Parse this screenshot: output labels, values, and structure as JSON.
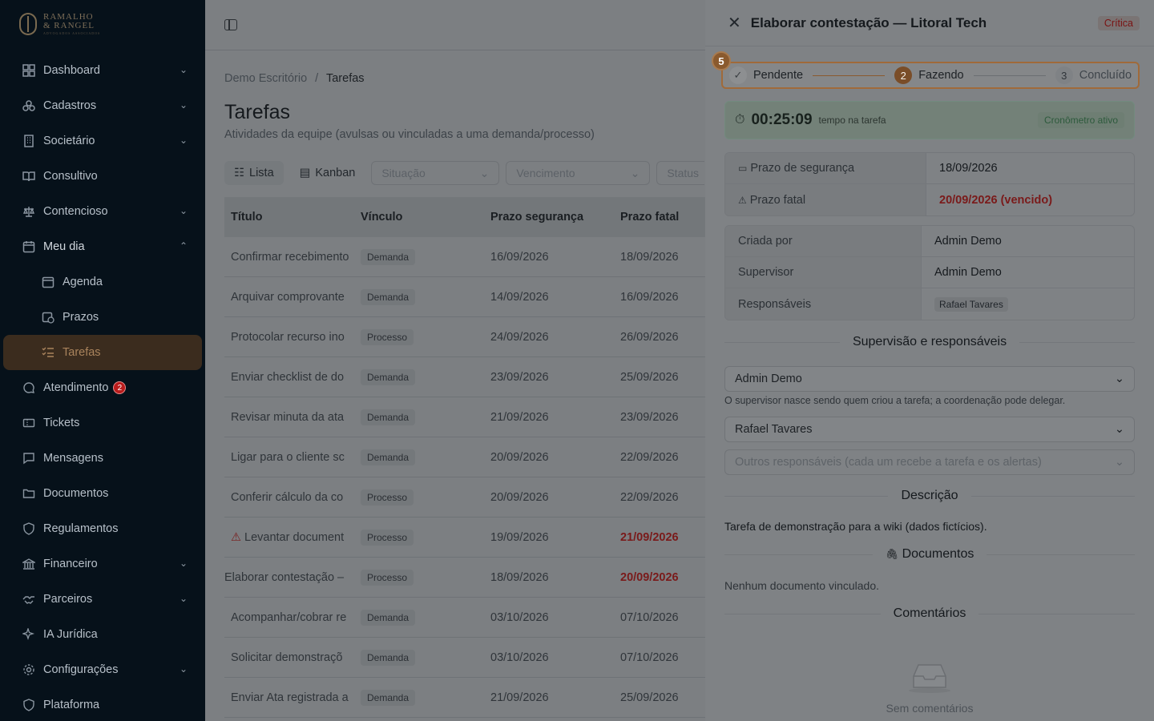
{
  "brand": {
    "line1": "RAMALHO",
    "line2": "& RANGEL",
    "line3": "ADVOGADOS ASSOCIADOS"
  },
  "sidebar": {
    "items": [
      {
        "label": "Dashboard",
        "icon": "dashboard-icon"
      },
      {
        "label": "Cadastros",
        "icon": "people-icon"
      },
      {
        "label": "Societário",
        "icon": "building-icon"
      },
      {
        "label": "Consultivo",
        "icon": "book-icon"
      },
      {
        "label": "Contencioso",
        "icon": "scale-icon"
      },
      {
        "label": "Meu dia",
        "icon": "calendar-icon"
      },
      {
        "label": "Agenda",
        "icon": "calendar-icon"
      },
      {
        "label": "Prazos",
        "icon": "calendar-clock-icon"
      },
      {
        "label": "Tarefas",
        "icon": "list-check-icon"
      },
      {
        "label": "Atendimento",
        "icon": "chat-icon",
        "badge": "2"
      },
      {
        "label": "Tickets",
        "icon": "ticket-icon"
      },
      {
        "label": "Mensagens",
        "icon": "message-icon"
      },
      {
        "label": "Documentos",
        "icon": "folder-icon"
      },
      {
        "label": "Regulamentos",
        "icon": "shield-icon"
      },
      {
        "label": "Financeiro",
        "icon": "bank-icon"
      },
      {
        "label": "Parceiros",
        "icon": "handshake-icon"
      },
      {
        "label": "IA Jurídica",
        "icon": "sparkles-icon"
      },
      {
        "label": "Configurações",
        "icon": "gear-icon"
      },
      {
        "label": "Plataforma",
        "icon": "shield-icon"
      }
    ]
  },
  "breadcrumb": {
    "root": "Demo Escritório",
    "sep": "/",
    "current": "Tarefas"
  },
  "page": {
    "title": "Tarefas",
    "subtitle": "Atividades da equipe (avulsas ou vinculadas a uma demanda/processo)"
  },
  "toolbar": {
    "lista": "Lista",
    "kanban": "Kanban",
    "situacao": "Situação",
    "vencimento": "Vencimento",
    "status": "Status"
  },
  "table": {
    "headers": [
      "Título",
      "Vínculo",
      "Prazo segurança",
      "Prazo fatal"
    ],
    "rows": [
      {
        "titulo": "Confirmar recebimento",
        "vinculo": "Demanda",
        "seg": "16/09/2026",
        "fatal": "18/09/2026",
        "late": false
      },
      {
        "titulo": "Arquivar comprovante",
        "vinculo": "Demanda",
        "seg": "14/09/2026",
        "fatal": "16/09/2026",
        "late": false
      },
      {
        "titulo": "Protocolar recurso ino",
        "vinculo": "Processo",
        "seg": "24/09/2026",
        "fatal": "26/09/2026",
        "late": false
      },
      {
        "titulo": "Enviar checklist de do",
        "vinculo": "Demanda",
        "seg": "23/09/2026",
        "fatal": "25/09/2026",
        "late": false
      },
      {
        "titulo": "Revisar minuta da ata",
        "vinculo": "Demanda",
        "seg": "21/09/2026",
        "fatal": "23/09/2026",
        "late": false
      },
      {
        "titulo": "Ligar para o cliente sc",
        "vinculo": "Demanda",
        "seg": "20/09/2026",
        "fatal": "22/09/2026",
        "late": false
      },
      {
        "titulo": "Conferir cálculo da co",
        "vinculo": "Processo",
        "seg": "20/09/2026",
        "fatal": "22/09/2026",
        "late": false
      },
      {
        "titulo": "Levantar document",
        "vinculo": "Processo",
        "seg": "19/09/2026",
        "fatal": "21/09/2026",
        "late": true,
        "warn": true
      },
      {
        "titulo": "Elaborar contestação –",
        "vinculo": "Processo",
        "seg": "18/09/2026",
        "fatal": "20/09/2026",
        "late": true
      },
      {
        "titulo": "Acompanhar/cobrar re",
        "vinculo": "Demanda",
        "seg": "03/10/2026",
        "fatal": "07/10/2026",
        "late": false
      },
      {
        "titulo": "Solicitar demonstraçõ",
        "vinculo": "Demanda",
        "seg": "03/10/2026",
        "fatal": "07/10/2026",
        "late": false
      },
      {
        "titulo": "Enviar Ata registrada a",
        "vinculo": "Demanda",
        "seg": "21/09/2026",
        "fatal": "25/09/2026",
        "late": false
      }
    ]
  },
  "drawer": {
    "title": "Elaborar contestação — Litoral Tech",
    "priority": "Crítica",
    "step_badge": "5",
    "steps": [
      {
        "num": "",
        "label": "Pendente",
        "state": "done"
      },
      {
        "num": "2",
        "label": "Fazendo",
        "state": "current"
      },
      {
        "num": "3",
        "label": "Concluído",
        "state": "next"
      }
    ],
    "timer": {
      "value": "00:25:09",
      "label": "tempo na tarefa",
      "status": "Cronômetro ativo"
    },
    "prazos": [
      {
        "k": "Prazo de segurança",
        "v": "18/09/2026",
        "icon": "calendar-icon"
      },
      {
        "k": "Prazo fatal",
        "v": "20/09/2026 (vencido)",
        "icon": "warning-icon"
      }
    ],
    "people": [
      {
        "k": "Criada por",
        "v": "Admin Demo"
      },
      {
        "k": "Supervisor",
        "v": "Admin Demo"
      },
      {
        "k": "Responsáveis",
        "v": "Rafael Tavares"
      }
    ],
    "sec_supervisao": "Supervisão e responsáveis",
    "supervisor_select": "Admin Demo",
    "hint": "O supervisor nasce sendo quem criou a tarefa; a coordenação pode delegar.",
    "responsavel_select": "Rafael Tavares",
    "outros_placeholder": "Outros responsáveis (cada um recebe a tarefa e os alertas)",
    "sec_descricao": "Descrição",
    "descricao": "Tarefa de demonstração para a wiki (dados fictícios).",
    "sec_documentos": "Documentos",
    "nodocs": "Nenhum documento vinculado.",
    "sec_comentarios": "Comentários",
    "sem_comentarios": "Sem comentários"
  }
}
